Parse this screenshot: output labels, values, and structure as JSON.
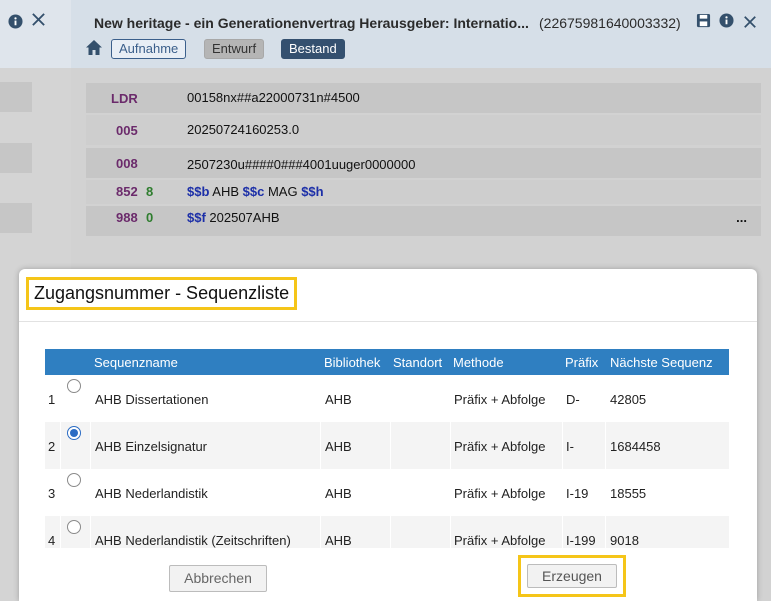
{
  "record": {
    "title": "New heritage - ein Generationenvertrag Herausgeber: Internatio...",
    "id": "(22675981640003332)",
    "status_buttons": {
      "aufnahme": "Aufnahme",
      "entwurf": "Entwurf",
      "bestand": "Bestand"
    }
  },
  "marc": {
    "ldr": {
      "tag": "LDR",
      "value": "00158nx##a22000731n#4500"
    },
    "f005": {
      "tag": "005",
      "value": "20250724160253.0"
    },
    "f008": {
      "tag": "008",
      "value": "2507230u####0###4001uuger0000000"
    },
    "f852": {
      "tag": "852",
      "ind": "8",
      "s1": "$$b",
      "v1": " AHB ",
      "s2": "$$c",
      "v2": " MAG ",
      "s3": "$$h"
    },
    "f988": {
      "tag": "988",
      "ind": "0",
      "s1": "$$f",
      "v1": " 202507AHB",
      "more": "..."
    }
  },
  "dialog": {
    "title": "Zugangsnummer - Sequenzliste",
    "columns": {
      "name": "Sequenzname",
      "library": "Bibliothek",
      "location": "Standort",
      "method": "Methode",
      "prefix": "Präfix",
      "next": "Nächste Sequenz"
    },
    "rows": [
      {
        "num": "1",
        "name": "AHB Dissertationen",
        "library": "AHB",
        "location": "",
        "method": "Präfix + Abfolge",
        "prefix": "D-",
        "next": "42805",
        "selected": false
      },
      {
        "num": "2",
        "name": "AHB Einzelsignatur",
        "library": "AHB",
        "location": "",
        "method": "Präfix + Abfolge",
        "prefix": "I-",
        "next": "1684458",
        "selected": true
      },
      {
        "num": "3",
        "name": "AHB Nederlandistik",
        "library": "AHB",
        "location": "",
        "method": "Präfix + Abfolge",
        "prefix": "I-19",
        "next": "18555",
        "selected": false
      },
      {
        "num": "4",
        "name": "AHB Nederlandistik (Zeitschriften)",
        "library": "AHB",
        "location": "",
        "method": "Präfix + Abfolge",
        "prefix": "I-199",
        "next": "9018",
        "selected": false
      }
    ],
    "cancel_label": "Abbrechen",
    "create_label": "Erzeugen"
  },
  "colors": {
    "accent": "#2f7fc1",
    "highlight": "#f5c518",
    "primary": "#34506f"
  }
}
